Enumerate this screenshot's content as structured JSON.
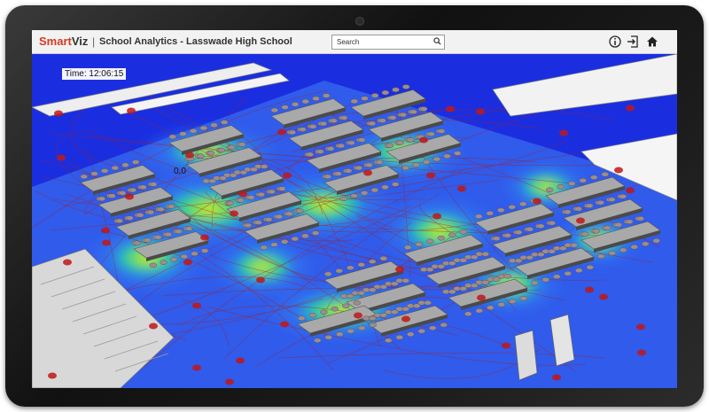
{
  "brand": {
    "prefix": "Smart",
    "suffix": "Viz",
    "accent": "#d43a22"
  },
  "header": {
    "separator": "|",
    "title": "School Analytics - Lasswade High School"
  },
  "search": {
    "placeholder": "Search",
    "icon": "search-icon"
  },
  "toolbar": {
    "icons": [
      "info-icon",
      "exit-icon",
      "home-icon"
    ]
  },
  "viz": {
    "time_label": "Time: 12:06:15",
    "origin_label": "0,0"
  },
  "colors": {
    "heat_low": "#1a35e8",
    "heat_mid": "#22d0a0",
    "heat_high": "#e8e020",
    "paths": "#b01818"
  }
}
